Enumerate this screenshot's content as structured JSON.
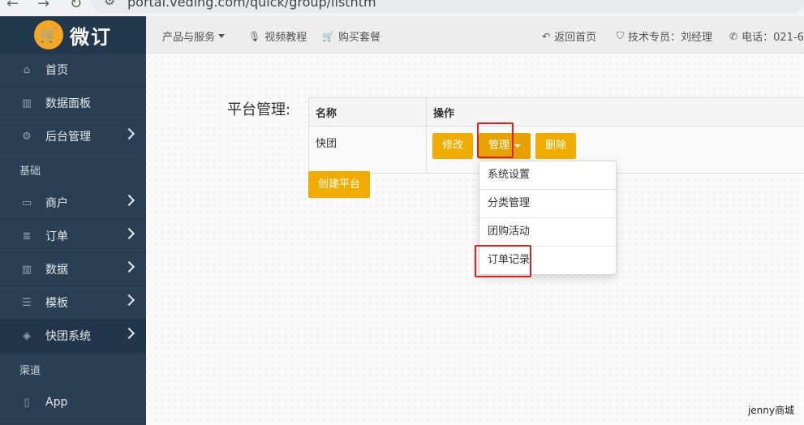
{
  "browser": {
    "url": "portal.veding.com/quick/group/listhtm"
  },
  "sidebar": {
    "logo_text": "微订",
    "items": [
      {
        "label": "首页",
        "icon": "⌂"
      },
      {
        "label": "数据面板",
        "icon": "▥"
      },
      {
        "label": "后台管理",
        "icon": "⚙"
      },
      {
        "label": "基础",
        "icon": ""
      },
      {
        "label": "商户",
        "icon": "▭"
      },
      {
        "label": "订单",
        "icon": "≣"
      },
      {
        "label": "数据",
        "icon": "▥"
      },
      {
        "label": "模板",
        "icon": "☰"
      },
      {
        "label": "快团系统",
        "icon": "◈"
      },
      {
        "label": "渠道",
        "icon": ""
      },
      {
        "label": "App",
        "icon": "▯"
      }
    ]
  },
  "topbar": {
    "products": "产品与服务",
    "video": "视频教程",
    "buy": "购买套餐",
    "home": "返回首页",
    "support": "技术专员：刘经理",
    "phone": "电话：021-6"
  },
  "main": {
    "page_label": "平台管理:",
    "table": {
      "headers": [
        "名称",
        "操作"
      ],
      "rows": [
        {
          "name": "快团"
        }
      ]
    },
    "buttons": {
      "edit": "修改",
      "manage": "管理",
      "delete": "删除",
      "create": "创建平台"
    },
    "dropdown": [
      "系统设置",
      "分类管理",
      "团购活动",
      "订单记录"
    ]
  },
  "watermark": "jenny商城",
  "colors": {
    "sidebar_bg": "#2a3f54",
    "button": "#f0ad00",
    "highlight": "#e02020"
  }
}
